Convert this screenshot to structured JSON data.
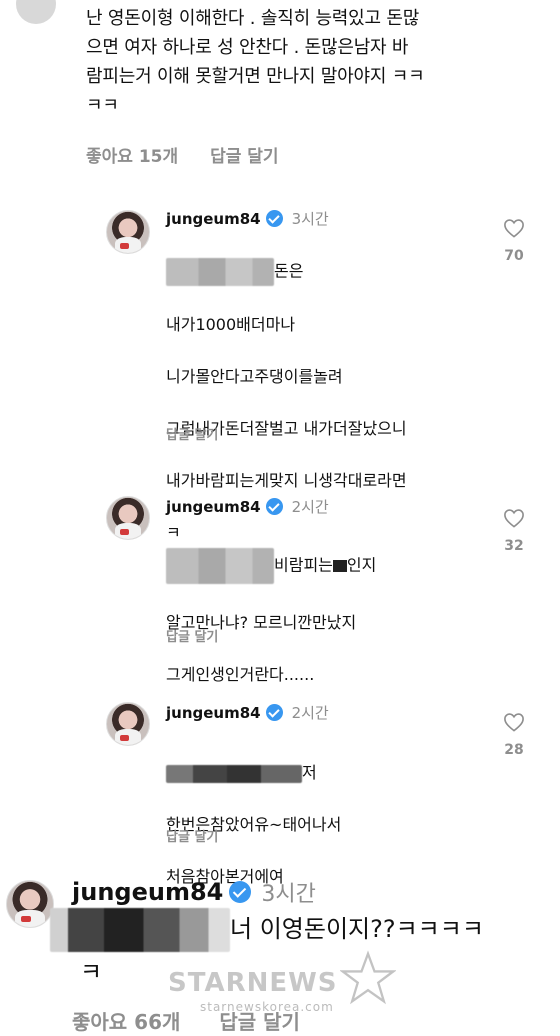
{
  "main_comment": {
    "lines": [
      "난 영돈이형 이해한다 . 솔직히 능력있고 돈많",
      "으면 여자 하나로 성 안찬다 .  돈많은남자 바",
      "람피는거 이해 못할거면 만나지 말아야지 ㅋㅋ",
      "ㅋㅋ"
    ],
    "likes": "좋아요 15개",
    "reply": "답글 달기"
  },
  "replies": [
    {
      "username": "jungeum84",
      "time": "3시간",
      "first_line_suffix": "돈은",
      "lines": [
        "내가1000배더마나",
        "니가몰안다고주댕이를놀려",
        "그럼내가돈더잘벌고 내가더잘났으니",
        "내가바람피는게맞지 니생각대로라면",
        "ㅋ"
      ],
      "reply": "답글 달기",
      "likes": "70"
    },
    {
      "username": "jungeum84",
      "time": "2시간",
      "first_line_mid": "비람피는",
      "first_line_suffix": "인지",
      "lines": [
        "알고만나냐? 모르니깐만났지",
        "그게인생인거란다......"
      ],
      "reply": "답글 달기",
      "likes": "32"
    },
    {
      "username": "jungeum84",
      "time": "2시간",
      "first_line_suffix": "저",
      "lines": [
        "한번은참았어유~태어나서",
        "처음참아본거에여"
      ],
      "reply": "답글 달기",
      "likes": "28"
    }
  ],
  "big_comment": {
    "username": "jungeum84",
    "time": "3시간",
    "text_suffix": "너 이영돈이지??ㅋㅋㅋㅋ",
    "text_line2": "ㅋ",
    "likes": "좋아요 66개",
    "reply": "답글 달기"
  },
  "watermark": {
    "brand": "STARNEWS",
    "site": "starnewskorea.com"
  },
  "colors": {
    "verified": "#3897f0",
    "meta_gray": "#8e8e8e",
    "text": "#111111"
  }
}
